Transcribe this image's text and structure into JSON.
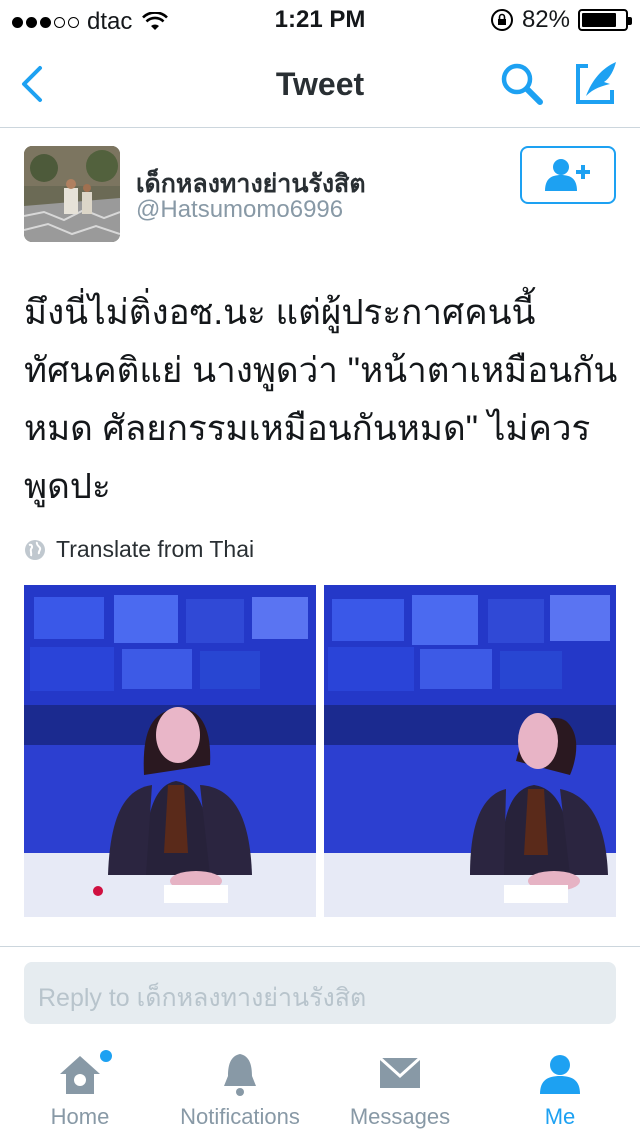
{
  "status_bar": {
    "carrier": "dtac",
    "time": "1:21 PM",
    "battery": "82%",
    "battery_level": 0.82,
    "signal_bars_filled": 3,
    "signal_bars_total": 5
  },
  "nav": {
    "title": "Tweet",
    "back_icon": "chevron-left-icon",
    "search_icon": "search-icon",
    "compose_icon": "compose-icon"
  },
  "tweet": {
    "display_name": "เด็กหลงทางย่านรังสิต",
    "handle": "@Hatsumomo6996",
    "text": "มึงนี่ไม่ติ่งอซ.นะ แต่ผู้ประกาศคนนี้ทัศนคติแย่ นางพูดว่า \"หน้าตาเหมือนกันหมด ศัลยกรรมเหมือนกันหมด\" ไม่ควรพูดปะ",
    "translate_label": "Translate from Thai"
  },
  "reply": {
    "placeholder": "Reply to เด็กหลงทางย่านรังสิต"
  },
  "tabs": [
    {
      "label": "Home",
      "icon": "home-icon",
      "active": false,
      "has_badge": true
    },
    {
      "label": "Notifications",
      "icon": "bell-icon",
      "active": false
    },
    {
      "label": "Messages",
      "icon": "envelope-icon",
      "active": false
    },
    {
      "label": "Me",
      "icon": "person-icon",
      "active": true
    }
  ],
  "colors": {
    "accent": "#1da1f2",
    "inactive": "#8899a6",
    "divider": "#ccd6dd"
  }
}
